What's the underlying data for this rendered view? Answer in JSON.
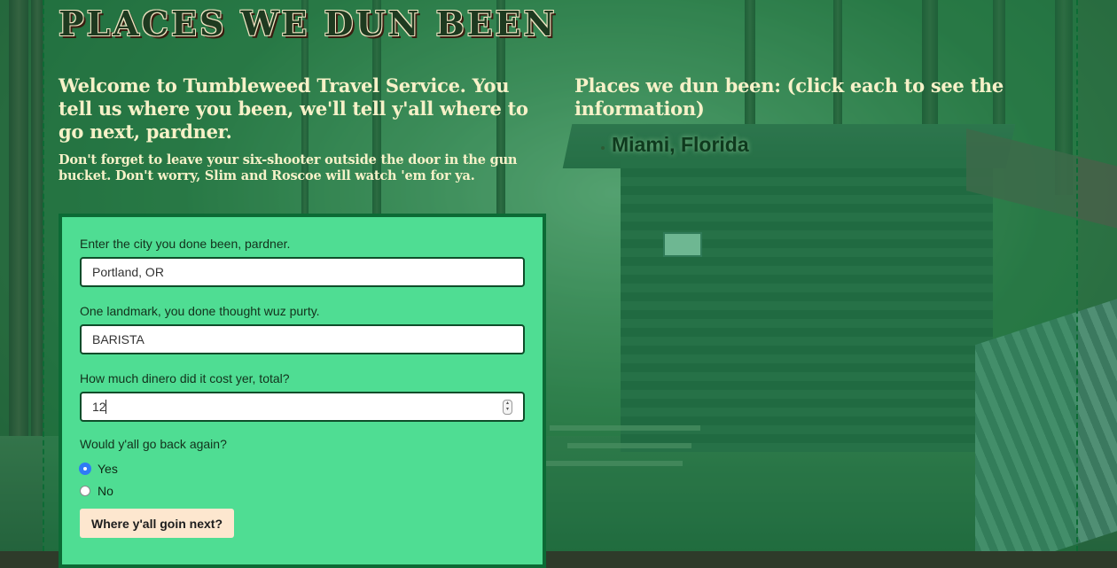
{
  "page": {
    "title": "PLACES WE DUN BEEN",
    "welcome": "Welcome to Tumbleweed Travel Service. You tell us where you been, we'll tell y'all where to go next, pardner.",
    "reminder": "Don't forget to leave your six-shooter outside the door in the gun bucket. Don't worry, Slim and Roscoe will watch 'em for ya."
  },
  "visited": {
    "heading": "Places we dun been: (click each to see the information)",
    "places": [
      "Miami, Florida"
    ]
  },
  "form": {
    "city_label": "Enter the city you done been, pardner.",
    "city_value": "Portland, OR",
    "landmark_label": "One landmark, you done thought wuz purty.",
    "landmark_value": "BARISTA",
    "cost_label": "How much dinero did it cost yer, total?",
    "cost_value": "12",
    "return_label": "Would y'all go back again?",
    "options": [
      {
        "label": "Yes",
        "selected": true
      },
      {
        "label": "No",
        "selected": false
      }
    ],
    "submit_label": "Where y'all goin next?"
  },
  "colors": {
    "form_bg": "#4fdd93",
    "form_border": "#0c6a35",
    "button_bg": "#fde7cf",
    "heading_text": "#f6f1c8"
  }
}
